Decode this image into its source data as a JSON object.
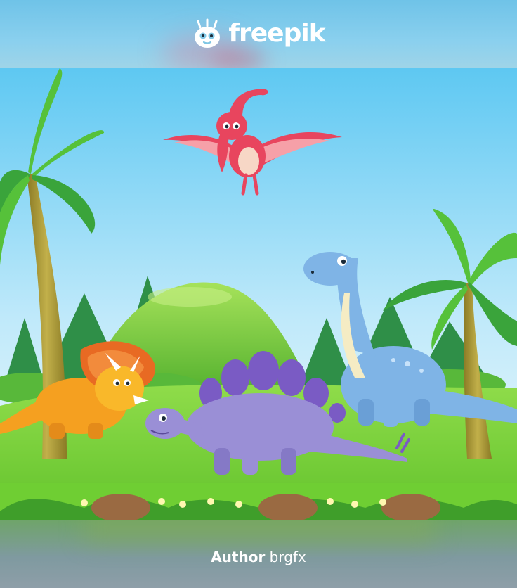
{
  "header": {
    "brand_name": "freepik"
  },
  "footer": {
    "author_label": "Author",
    "author_name": "brgfx"
  },
  "colors": {
    "sky_top": "#5ec8f2",
    "sky_bottom": "#dff3fb",
    "grass": "#7ed53a",
    "pterodactyl": "#e8455e",
    "triceratops": "#f5a020",
    "stegosaurus": "#9a8fd6",
    "brontosaurus": "#7fb4e6"
  }
}
